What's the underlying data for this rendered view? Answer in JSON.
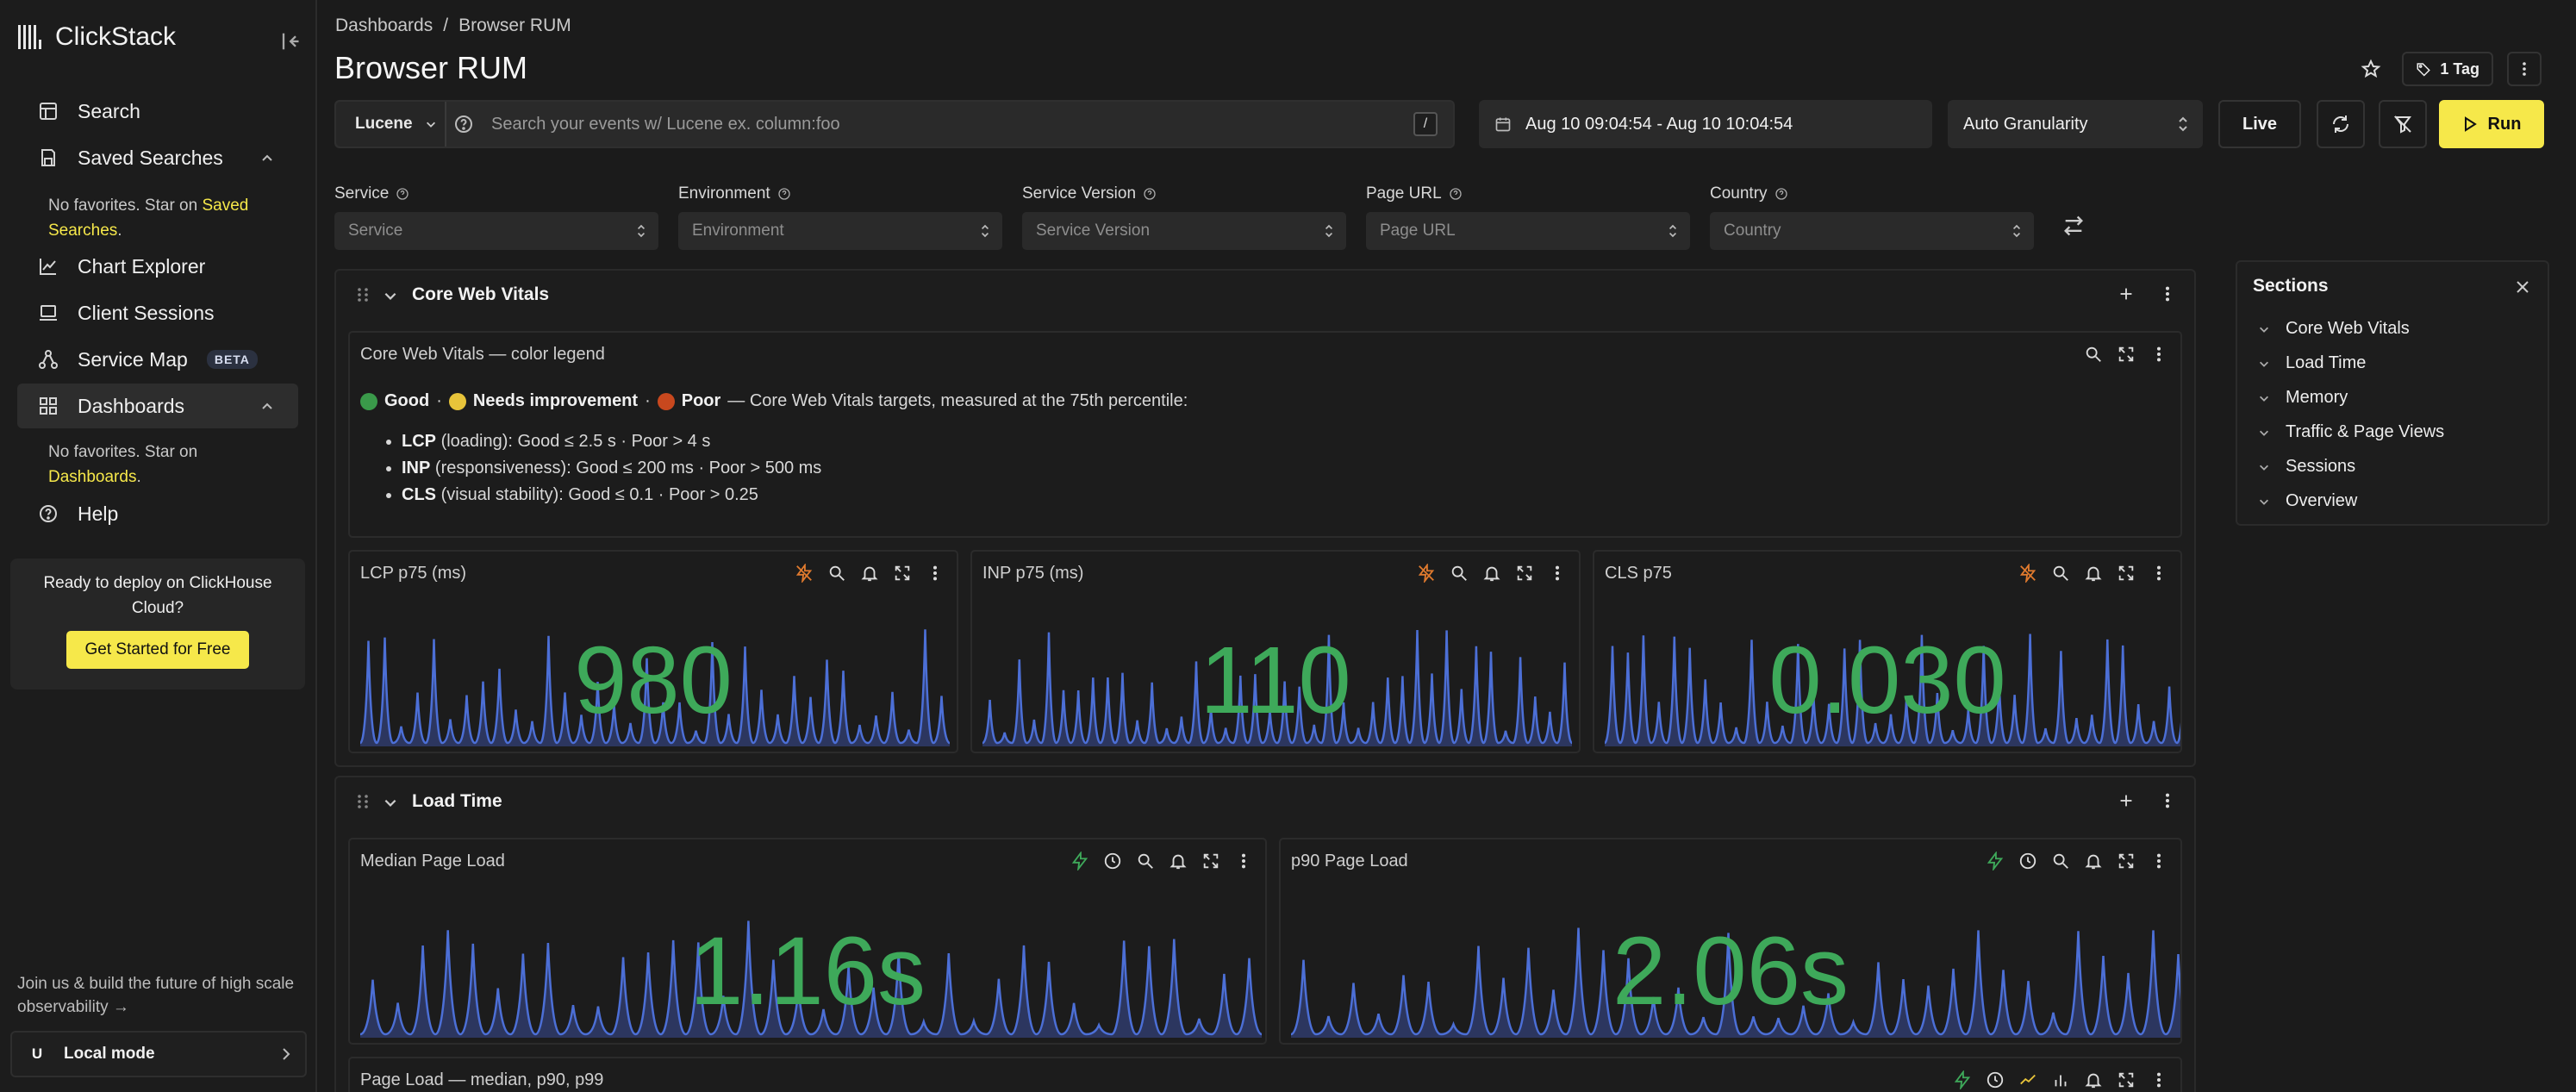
{
  "app": {
    "name": "ClickStack"
  },
  "sidebar": {
    "items": [
      {
        "label": "Search"
      },
      {
        "label": "Saved Searches"
      },
      {
        "label": "Chart Explorer"
      },
      {
        "label": "Client Sessions"
      },
      {
        "label": "Service Map",
        "badge": "BETA"
      },
      {
        "label": "Dashboards"
      },
      {
        "label": "Help"
      }
    ],
    "saved_note_pre": "No favorites. Star on ",
    "saved_note_link": "Saved Searches",
    "saved_note_post": ".",
    "dash_note_pre": "No favorites. Star on ",
    "dash_note_link": "Dashboards",
    "dash_note_post": ".",
    "deploy_text": "Ready to deploy on ClickHouse Cloud?",
    "deploy_button": "Get Started for Free",
    "join_text": "Join us & build the future of high scale observability →",
    "user_initial": "U",
    "mode_label": "Local mode"
  },
  "breadcrumb": {
    "parent": "Dashboards",
    "separator": "/",
    "current": "Browser RUM"
  },
  "page_title": "Browser RUM",
  "header": {
    "tag_label": "1 Tag"
  },
  "toolbar": {
    "query_language": "Lucene",
    "search_placeholder": "Search your events w/ Lucene ex. column:foo",
    "shortcut": "/",
    "date_range": "Aug 10 09:04:54 - Aug 10 10:04:54",
    "granularity": "Auto Granularity",
    "live_label": "Live",
    "run_label": "Run"
  },
  "filters": [
    {
      "label": "Service",
      "placeholder": "Service"
    },
    {
      "label": "Environment",
      "placeholder": "Environment"
    },
    {
      "label": "Service Version",
      "placeholder": "Service Version"
    },
    {
      "label": "Page URL",
      "placeholder": "Page URL"
    },
    {
      "label": "Country",
      "placeholder": "Country"
    }
  ],
  "sections": [
    {
      "title": "Core Web Vitals",
      "legend": {
        "title": "Core Web Vitals — color legend",
        "good": "Good",
        "sep": "·",
        "needs": "Needs improvement",
        "poor": "Poor",
        "intro": "— Core Web Vitals targets, measured at the 75th percentile:",
        "rows": [
          {
            "key": "LCP",
            "text": "(loading): Good ≤ 2.5 s · Poor > 4 s"
          },
          {
            "key": "INP",
            "text": "(responsiveness): Good ≤ 200 ms · Poor > 500 ms"
          },
          {
            "key": "CLS",
            "text": "(visual stability): Good ≤ 0.1 · Poor > 0.25"
          }
        ]
      },
      "tiles": [
        {
          "title": "LCP p75 (ms)",
          "value": "980"
        },
        {
          "title": "INP p75 (ms)",
          "value": "110"
        },
        {
          "title": "CLS p75",
          "value": "0.030"
        }
      ]
    },
    {
      "title": "Load Time",
      "tiles": [
        {
          "title": "Median Page Load",
          "value": "1.16s"
        },
        {
          "title": "p90 Page Load",
          "value": "2.06s"
        },
        {
          "title": "Page Load — median, p90, p99"
        }
      ]
    }
  ],
  "sections_panel": {
    "title": "Sections",
    "items": [
      "Core Web Vitals",
      "Load Time",
      "Memory",
      "Traffic & Page Views",
      "Sessions",
      "Overview"
    ]
  },
  "colors": {
    "accent": "#f6e84a",
    "value_green": "#3ea95a",
    "spark_fill": "#2f3b6b",
    "spark_line": "#4c6fd6",
    "good": "#3a9a4a",
    "needs": "#e8c43a",
    "poor": "#c8481e"
  },
  "icons": [
    "grid-logo-icon",
    "collapse-icon",
    "search-icon",
    "saved-icon",
    "chart-icon",
    "laptop-icon",
    "map-icon",
    "dashboard-icon",
    "help-icon",
    "star-icon",
    "tag-icon",
    "kebab-icon",
    "calendar-icon",
    "refresh-icon",
    "filter-off-icon",
    "play-icon",
    "swap-icon",
    "grip-icon",
    "chevron-down-icon",
    "plus-icon",
    "zoom-icon",
    "bell-icon",
    "expand-icon",
    "bolt-icon",
    "clock-icon",
    "no-bolt-icon",
    "close-icon"
  ]
}
